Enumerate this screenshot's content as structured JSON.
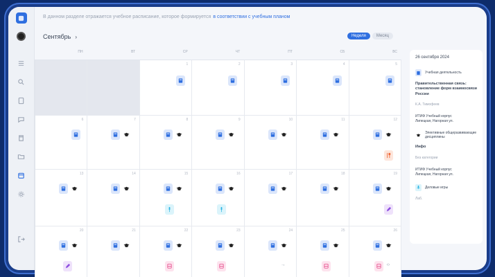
{
  "app": {
    "logo_text": "",
    "info_text": "В данном разделе отражается учебное расписание, которое формируется",
    "info_link": "в соответствии с учебным планом"
  },
  "header": {
    "month": "Сентябрь",
    "chevron": "›",
    "toggle": [
      "Неделя",
      "Месяц"
    ]
  },
  "calendar": {
    "weekdays": [
      "ПН",
      "ВТ",
      "СР",
      "ЧТ",
      "ПТ",
      "СБ",
      "ВС"
    ],
    "day_numbers": [
      "",
      "",
      "1",
      "2",
      "3",
      "4",
      "5",
      "6",
      "7",
      "8",
      "9",
      "10",
      "11",
      "12",
      "13",
      "14",
      "15",
      "16",
      "17",
      "18",
      "19",
      "20",
      "21",
      "22",
      "23",
      "24",
      "25",
      "26"
    ]
  },
  "panel": {
    "date": "26 сентября 2024",
    "item1_label": "Учебная деятельность",
    "title": "Правительственная связь: становление форм взаимосвязи России",
    "teacher1": "К.А. Тимофеев",
    "room1": "ИТИФ Учебный корпус",
    "room1b": "Липецкая, Нагорная ул.",
    "item2_label": "Элективные общеразвивающие",
    "item2_line2": "дисциплины",
    "info_title": "Инфо",
    "info_text": "Без категории",
    "room2": "ИТИФ Учебный корпус",
    "room2b": "Липецкая, Нагорная ул.",
    "item3_label": "Деловые игры",
    "item3_line2": "Лаб."
  },
  "colors": {
    "accent": "#2f6fe0",
    "frame": "#1a3d8a",
    "book_bg": "#dbe6fb",
    "pink": "#e85a94",
    "purple": "#8e4fe0",
    "cyan": "#2bb4e3",
    "orange": "#f06a3a"
  },
  "icons": [
    "book-icon",
    "graduation-cap-icon",
    "bus-icon",
    "microphone-icon",
    "pen-icon",
    "fork-knife-icon",
    "arrow-icon"
  ]
}
